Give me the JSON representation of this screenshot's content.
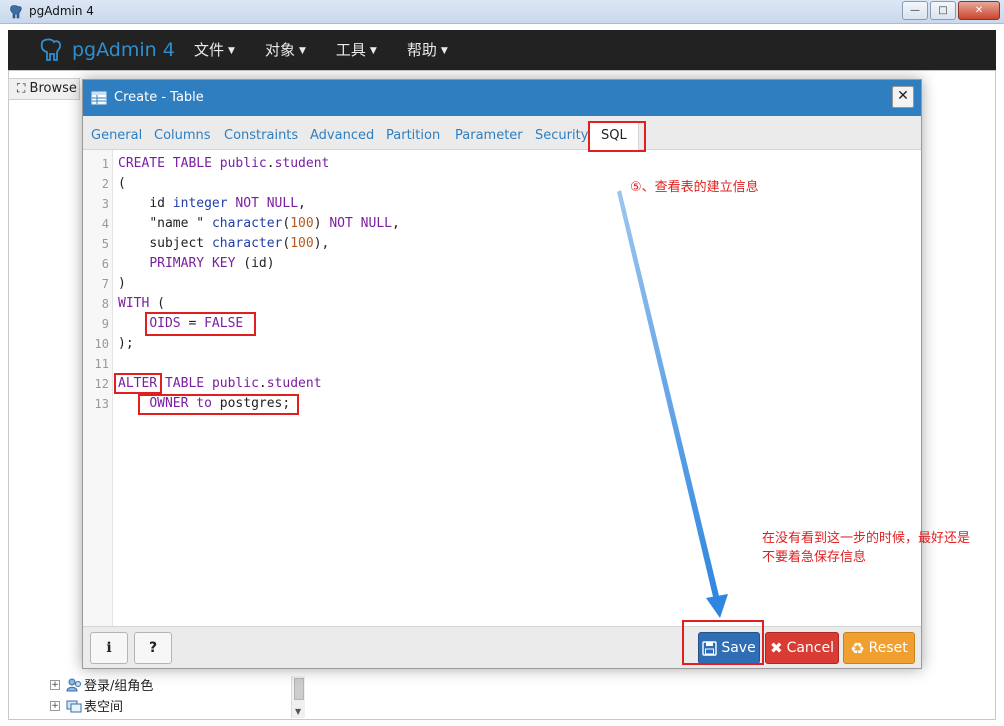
{
  "window": {
    "title": "pgAdmin 4",
    "buttons": {
      "minimize": "—",
      "maximize": "□",
      "close": "✕"
    }
  },
  "navbar": {
    "brand": "pgAdmin 4",
    "menus": [
      {
        "label": "文件"
      },
      {
        "label": "对象"
      },
      {
        "label": "工具"
      },
      {
        "label": "帮助"
      }
    ]
  },
  "browser": {
    "tab_label": "Browse",
    "tree_items": [
      {
        "label": "登录/组角色",
        "icon": "role-icon"
      },
      {
        "label": "表空间",
        "icon": "tablespace-icon"
      }
    ]
  },
  "dialog": {
    "title": "Create - Table",
    "close_label": "✕",
    "tabs": [
      {
        "label": "General"
      },
      {
        "label": "Columns"
      },
      {
        "label": "Constraints"
      },
      {
        "label": "Advanced"
      },
      {
        "label": "Partition"
      },
      {
        "label": "Parameter"
      },
      {
        "label": "Security"
      },
      {
        "label": "SQL",
        "active": true
      }
    ],
    "sql_lines": [
      "CREATE TABLE public.student",
      "(",
      "    id integer NOT NULL,",
      "    \"name \" character(100) NOT NULL,",
      "    subject character(100),",
      "    PRIMARY KEY (id)",
      ")",
      "WITH (",
      "    OIDS = FALSE",
      ");",
      "",
      "ALTER TABLE public.student",
      "    OWNER to postgres;"
    ],
    "footer": {
      "info_label": "i",
      "help_label": "?",
      "save_label": "Save",
      "cancel_label": "Cancel",
      "reset_label": "Reset"
    }
  },
  "annotations": {
    "step_note": "⑤、查看表的建立信息",
    "warning_line1": "在没有看到这一步的时候，最好还是",
    "warning_line2": "不要着急保存信息",
    "color": "#e02020"
  },
  "colors": {
    "dialog_header": "#2f7fc0",
    "navbar": "#222222",
    "save": "#2f6eb5",
    "cancel": "#d83c33",
    "reset": "#f0a030"
  }
}
